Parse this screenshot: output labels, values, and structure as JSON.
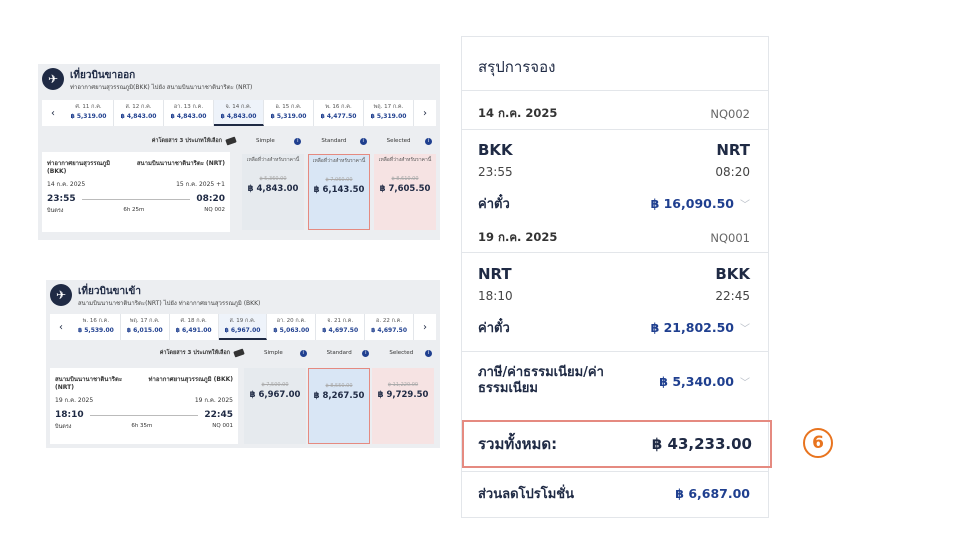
{
  "outbound": {
    "title": "เที่ยวบินขาออก",
    "subtitle": "ท่าอากาศยานสุวรรณภูมิ(BKK) ไปยัง สนามบินนานาชาตินาริตะ (NRT)",
    "prev_arrow": "‹",
    "next_arrow": "›",
    "dates": [
      {
        "label": "ศ. 11 ก.ค.",
        "price": "฿ 5,319.00",
        "active": false
      },
      {
        "label": "ส. 12 ก.ค.",
        "price": "฿ 4,843.00",
        "active": false
      },
      {
        "label": "อา. 13 ก.ค.",
        "price": "฿ 4,843.00",
        "active": false
      },
      {
        "label": "จ. 14 ก.ค.",
        "price": "฿ 4,843.00",
        "active": true
      },
      {
        "label": "อ. 15 ก.ค.",
        "price": "฿ 5,319.00",
        "active": false
      },
      {
        "label": "พ. 16 ก.ค.",
        "price": "฿ 4,477.50",
        "active": false
      },
      {
        "label": "พฤ. 17 ก.ค.",
        "price": "฿ 5,319.00",
        "active": false
      }
    ],
    "fare_note": "ค่าโดยสาร 3 ประเภทให้เลือก",
    "fare_types": [
      "Simple",
      "Standard",
      "Selected"
    ],
    "info_glyph": "i",
    "flight": {
      "from_name": "ท่าอากาศยานสุวรรณภูมิ (BKK)",
      "to_name": "สนามบินนานาชาตินาริตะ (NRT)",
      "dep_date": "14 ก.ค. 2025",
      "arr_date": "15 ก.ค. 2025 +1",
      "dep_time": "23:55",
      "arr_time": "08:20",
      "type": "บินตรง",
      "duration": "6h 25m",
      "number": "NQ 002"
    },
    "fares": [
      {
        "note": "เหลือที่ว่างสำหรับราคานี้",
        "old": "฿ 5,360.00",
        "price": "฿ 4,843.00"
      },
      {
        "note": "เหลือที่ว่างสำหรับราคานี้",
        "old": "฿ 7,060.00",
        "price": "฿ 6,143.50"
      },
      {
        "note": "เหลือที่ว่างสำหรับราคานี้",
        "old": "฿ 8,610.00",
        "price": "฿ 7,605.50"
      }
    ]
  },
  "inbound": {
    "title": "เที่ยวบินขาเข้า",
    "subtitle": "สนามบินนานาชาตินาริตะ(NRT) ไปยัง ท่าอากาศยานสุวรรณภูมิ (BKK)",
    "prev_arrow": "‹",
    "next_arrow": "›",
    "dates": [
      {
        "label": "พ. 16 ก.ค.",
        "price": "฿ 5,539.00",
        "active": false
      },
      {
        "label": "พฤ. 17 ก.ค.",
        "price": "฿ 6,015.00",
        "active": false
      },
      {
        "label": "ศ. 18 ก.ค.",
        "price": "฿ 6,491.00",
        "active": false
      },
      {
        "label": "ส. 19 ก.ค.",
        "price": "฿ 6,967.00",
        "active": true
      },
      {
        "label": "อา. 20 ก.ค.",
        "price": "฿ 5,063.00",
        "active": false
      },
      {
        "label": "จ. 21 ก.ค.",
        "price": "฿ 4,697.50",
        "active": false
      },
      {
        "label": "อ. 22 ก.ค.",
        "price": "฿ 4,697.50",
        "active": false
      }
    ],
    "fare_note": "ค่าโดยสาร 3 ประเภทให้เลือก",
    "fare_types": [
      "Simple",
      "Standard",
      "Selected"
    ],
    "info_glyph": "i",
    "flight": {
      "from_name": "สนามบินนานาชาตินาริตะ (NRT)",
      "to_name": "ท่าอากาศยานสุวรรณภูมิ (BKK)",
      "dep_date": "19 ก.ค. 2025",
      "arr_date": "19 ก.ค. 2025",
      "dep_time": "18:10",
      "arr_time": "22:45",
      "type": "บินตรง",
      "duration": "6h 35m",
      "number": "NQ 001"
    },
    "fares": [
      {
        "note": "",
        "old": "฿ 7,500.00",
        "price": "฿ 6,967.00"
      },
      {
        "note": "",
        "old": "฿ 8,550.00",
        "price": "฿ 8,267.50"
      },
      {
        "note": "",
        "old": "฿ 11,220.00",
        "price": "฿ 9,729.50"
      }
    ]
  },
  "summary": {
    "title": "สรุปการจอง",
    "outbound": {
      "date": "14 ก.ค. 2025",
      "code": "NQ002",
      "from": "BKK",
      "to": "NRT",
      "dep": "23:55",
      "arr": "08:20",
      "fare_label": "ค่าตั๋ว",
      "fare": "฿ 16,090.50"
    },
    "inbound": {
      "date": "19 ก.ค. 2025",
      "code": "NQ001",
      "from": "NRT",
      "to": "BKK",
      "dep": "18:10",
      "arr": "22:45",
      "fare_label": "ค่าตั๋ว",
      "fare": "฿ 21,802.50"
    },
    "tax_label": "ภาษี/ค่าธรรมเนียม/ค่าธรรมเนียม",
    "tax": "฿ 5,340.00",
    "total_label": "รวมทั้งหมด:",
    "total": "฿ 43,233.00",
    "discount_label": "ส่วนลดโปรโมชั่น",
    "discount": "฿ 6,687.00",
    "chevron": "﹀"
  },
  "step_marker": "6",
  "colors": {
    "navy": "#1f2a44",
    "price_blue": "#1f3f8f",
    "highlight": "#e58a80",
    "marker": "#e8741f"
  }
}
